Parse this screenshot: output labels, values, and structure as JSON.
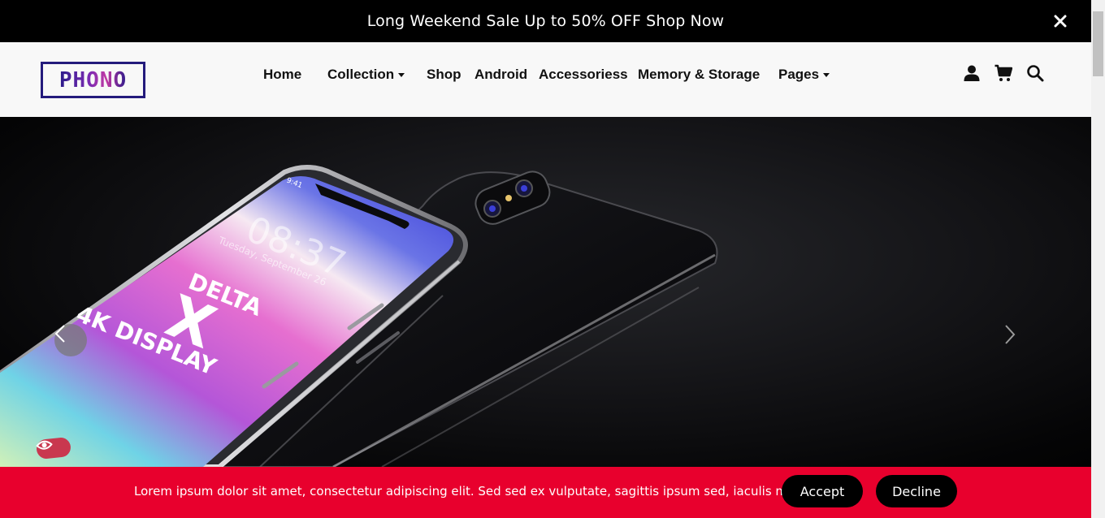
{
  "announcement": {
    "text": "Long Weekend Sale Up to 50% OFF Shop Now",
    "close_icon": "close-icon"
  },
  "brand": {
    "logo_text": "PHONO",
    "accent": "#241b7c"
  },
  "nav": {
    "items": [
      {
        "label": "Home",
        "dropdown": false
      },
      {
        "label": "Collection",
        "dropdown": true
      },
      {
        "label": "Shop",
        "dropdown": false
      },
      {
        "label": "Android",
        "dropdown": false
      },
      {
        "label": "Accessoriess",
        "dropdown": false
      },
      {
        "label": "Memory & Storage",
        "dropdown": false
      },
      {
        "label": "Pages",
        "dropdown": true
      }
    ],
    "icons": [
      "user-icon",
      "cart-icon",
      "search-icon"
    ]
  },
  "hero": {
    "phone_screen_text": {
      "brand": "DELTA",
      "model": "X",
      "feature": "4K DISPLAY",
      "time": "9:41",
      "clock": "08:37",
      "date": "Tuesday, September 26"
    },
    "prev_icon": "chevron-left-icon",
    "next_icon": "chevron-right-icon",
    "badge_icon": "eye-icon"
  },
  "cookie": {
    "text": "Lorem ipsum dolor sit amet, consectetur adipiscing elit. Sed sed ex vulputate, sagittis ipsum sed, iaculis magna.",
    "accept_label": "Accept",
    "decline_label": "Decline",
    "background": "#e8002d"
  }
}
